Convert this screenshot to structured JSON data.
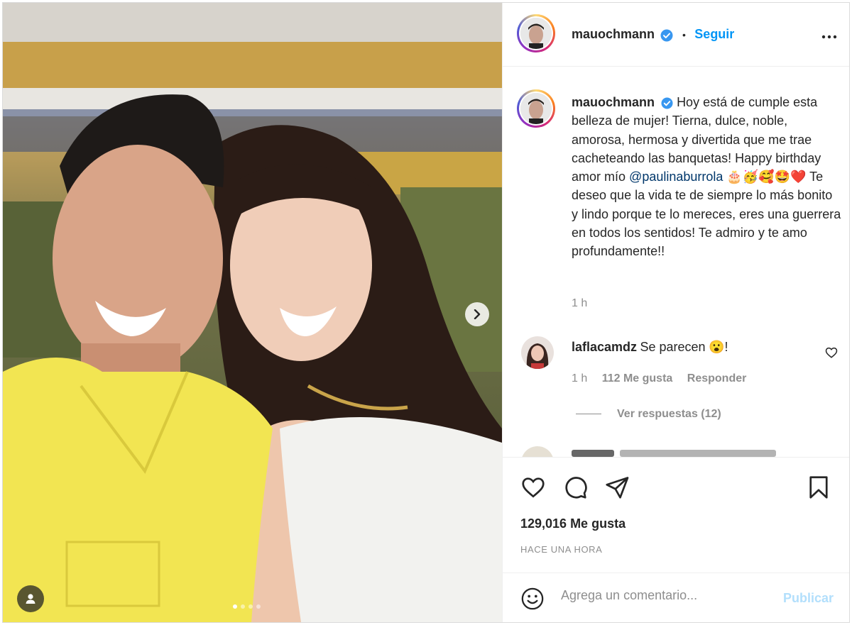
{
  "post": {
    "username": "mauochmann",
    "follow_label": "Seguir",
    "separator": "•",
    "caption": {
      "username": "mauochmann",
      "text_before_mention": "Hoy está de cumple esta belleza de mujer! Tierna, dulce, noble, amorosa, hermosa y divertida que me trae cacheteando las banquetas! Happy birthday amor mío",
      "mention": "@paulinaburrola",
      "emojis": "🎂🥳🥰🤩❤️",
      "text_after_mention": "Te deseo que la vida te de siempre lo más bonito y lindo porque te lo mereces, eres una guerrera en todos los sentidos! Te admiro y te amo profundamente!!",
      "time": "1 h"
    },
    "comments": [
      {
        "username": "laflacamdz",
        "text": "Se parecen",
        "emoji": "😮",
        "trail": "!",
        "time": "1 h",
        "likes": "112 Me gusta",
        "reply_label": "Responder",
        "view_replies": "Ver respuestas (12)"
      }
    ],
    "likes_count": "129,016 Me gusta",
    "timestamp": "HACE UNA HORA",
    "comment_placeholder": "Agrega un comentario...",
    "publish_label": "Publicar",
    "carousel": {
      "total": 4,
      "current": 1
    }
  },
  "colors": {
    "accent": "#0095f6",
    "publish_disabled": "#b2dffc",
    "text": "#262626",
    "muted": "#8e8e8e",
    "mention": "#00376b"
  },
  "icons": [
    "chevron-right-icon",
    "user-tag-icon",
    "verified-badge-icon",
    "more-options-icon",
    "heart-icon",
    "comment-icon",
    "share-icon",
    "bookmark-icon",
    "emoji-icon"
  ]
}
